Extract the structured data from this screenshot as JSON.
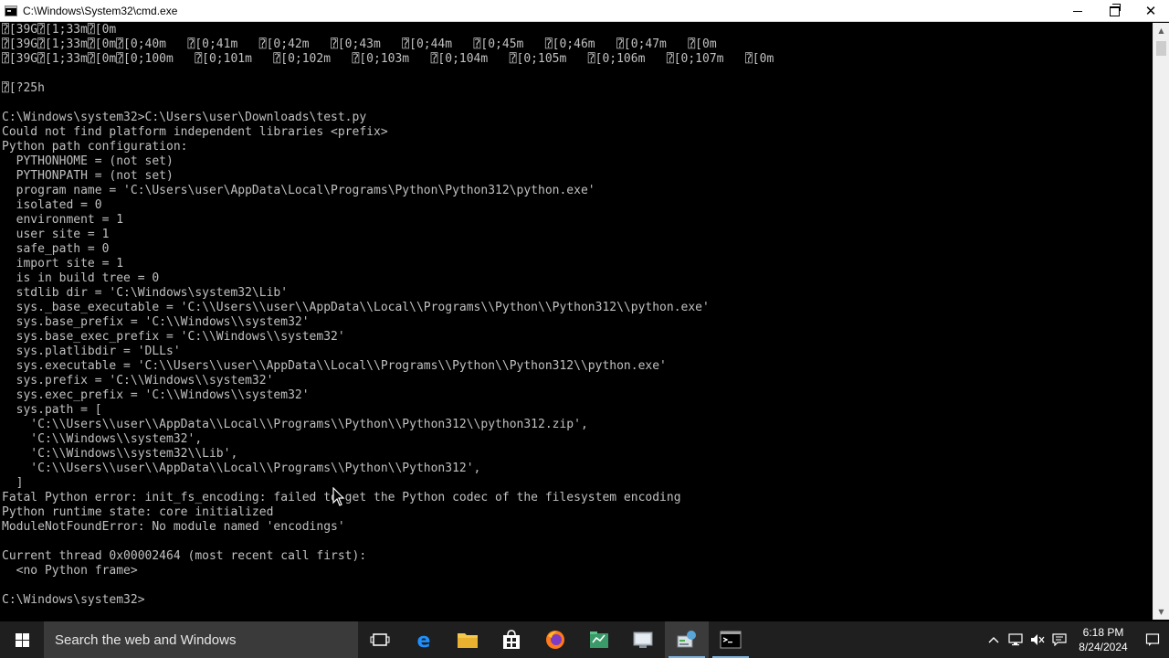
{
  "window": {
    "title": "C:\\Windows\\System32\\cmd.exe"
  },
  "console": {
    "lines": [
      "⍰[39G⍰[1;33m⍰[0m",
      "⍰[39G⍰[1;33m⍰[0m⍰[0;40m   ⍰[0;41m   ⍰[0;42m   ⍰[0;43m   ⍰[0;44m   ⍰[0;45m   ⍰[0;46m   ⍰[0;47m   ⍰[0m",
      "⍰[39G⍰[1;33m⍰[0m⍰[0;100m   ⍰[0;101m   ⍰[0;102m   ⍰[0;103m   ⍰[0;104m   ⍰[0;105m   ⍰[0;106m   ⍰[0;107m   ⍰[0m",
      "",
      "⍰[?25h",
      "",
      "C:\\Windows\\system32>C:\\Users\\user\\Downloads\\test.py",
      "Could not find platform independent libraries <prefix>",
      "Python path configuration:",
      "  PYTHONHOME = (not set)",
      "  PYTHONPATH = (not set)",
      "  program name = 'C:\\Users\\user\\AppData\\Local\\Programs\\Python\\Python312\\python.exe'",
      "  isolated = 0",
      "  environment = 1",
      "  user site = 1",
      "  safe_path = 0",
      "  import site = 1",
      "  is in build tree = 0",
      "  stdlib dir = 'C:\\Windows\\system32\\Lib'",
      "  sys._base_executable = 'C:\\\\Users\\\\user\\\\AppData\\\\Local\\\\Programs\\\\Python\\\\Python312\\\\python.exe'",
      "  sys.base_prefix = 'C:\\\\Windows\\\\system32'",
      "  sys.base_exec_prefix = 'C:\\\\Windows\\\\system32'",
      "  sys.platlibdir = 'DLLs'",
      "  sys.executable = 'C:\\\\Users\\\\user\\\\AppData\\\\Local\\\\Programs\\\\Python\\\\Python312\\\\python.exe'",
      "  sys.prefix = 'C:\\\\Windows\\\\system32'",
      "  sys.exec_prefix = 'C:\\\\Windows\\\\system32'",
      "  sys.path = [",
      "    'C:\\\\Users\\\\user\\\\AppData\\\\Local\\\\Programs\\\\Python\\\\Python312\\\\python312.zip',",
      "    'C:\\\\Windows\\\\system32',",
      "    'C:\\\\Windows\\\\system32\\\\Lib',",
      "    'C:\\\\Users\\\\user\\\\AppData\\\\Local\\\\Programs\\\\Python\\\\Python312',",
      "  ]",
      "Fatal Python error: init_fs_encoding: failed to get the Python codec of the filesystem encoding",
      "Python runtime state: core initialized",
      "ModuleNotFoundError: No module named 'encodings'",
      "",
      "Current thread 0x00002464 (most recent call first):",
      "  <no Python frame>",
      "",
      "C:\\Windows\\system32>"
    ]
  },
  "taskbar": {
    "search_placeholder": "Search the web and Windows",
    "apps": [
      {
        "icon": "task-view-icon",
        "running": false,
        "active": false
      },
      {
        "icon": "edge-icon",
        "running": false,
        "active": false
      },
      {
        "icon": "file-explorer-icon",
        "running": false,
        "active": false
      },
      {
        "icon": "store-icon",
        "running": false,
        "active": false
      },
      {
        "icon": "firefox-icon",
        "running": false,
        "active": false
      },
      {
        "icon": "spreadsheet-app-icon",
        "running": false,
        "active": false
      },
      {
        "icon": "network-tool-icon",
        "running": false,
        "active": false
      },
      {
        "icon": "control-panel-icon",
        "running": true,
        "active": true
      },
      {
        "icon": "cmd-icon",
        "running": true,
        "active": false
      }
    ],
    "time": "6:18 PM",
    "date": "8/24/2024"
  },
  "colors": {
    "console_text": "#c0c0c0",
    "console_bg": "#000000",
    "taskbar_bg": "#1f1f1f",
    "search_bg": "#3a3a3a"
  }
}
